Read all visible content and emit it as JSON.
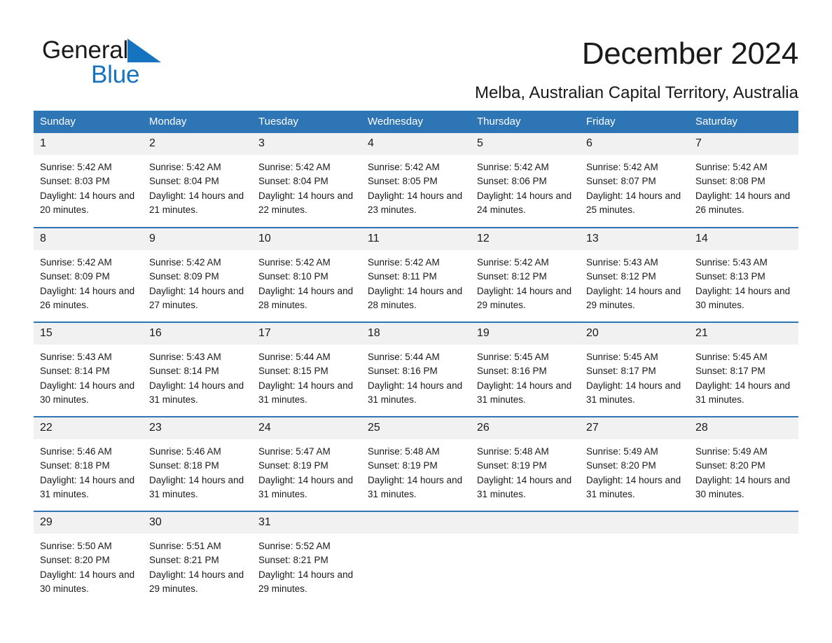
{
  "brand": {
    "name_part1": "General",
    "name_part2": "Blue",
    "triangle_color": "#1573c0"
  },
  "header": {
    "month_title": "December 2024",
    "location": "Melba, Australian Capital Territory, Australia",
    "accent_color": "#2e75b6",
    "daynum_band_color": "#f1f1f1"
  },
  "calendar": {
    "weekday_headers": [
      "Sunday",
      "Monday",
      "Tuesday",
      "Wednesday",
      "Thursday",
      "Friday",
      "Saturday"
    ],
    "weeks": [
      [
        {
          "day": "1",
          "sunrise": "Sunrise: 5:42 AM",
          "sunset": "Sunset: 8:03 PM",
          "daylight": "Daylight: 14 hours and 20 minutes."
        },
        {
          "day": "2",
          "sunrise": "Sunrise: 5:42 AM",
          "sunset": "Sunset: 8:04 PM",
          "daylight": "Daylight: 14 hours and 21 minutes."
        },
        {
          "day": "3",
          "sunrise": "Sunrise: 5:42 AM",
          "sunset": "Sunset: 8:04 PM",
          "daylight": "Daylight: 14 hours and 22 minutes."
        },
        {
          "day": "4",
          "sunrise": "Sunrise: 5:42 AM",
          "sunset": "Sunset: 8:05 PM",
          "daylight": "Daylight: 14 hours and 23 minutes."
        },
        {
          "day": "5",
          "sunrise": "Sunrise: 5:42 AM",
          "sunset": "Sunset: 8:06 PM",
          "daylight": "Daylight: 14 hours and 24 minutes."
        },
        {
          "day": "6",
          "sunrise": "Sunrise: 5:42 AM",
          "sunset": "Sunset: 8:07 PM",
          "daylight": "Daylight: 14 hours and 25 minutes."
        },
        {
          "day": "7",
          "sunrise": "Sunrise: 5:42 AM",
          "sunset": "Sunset: 8:08 PM",
          "daylight": "Daylight: 14 hours and 26 minutes."
        }
      ],
      [
        {
          "day": "8",
          "sunrise": "Sunrise: 5:42 AM",
          "sunset": "Sunset: 8:09 PM",
          "daylight": "Daylight: 14 hours and 26 minutes."
        },
        {
          "day": "9",
          "sunrise": "Sunrise: 5:42 AM",
          "sunset": "Sunset: 8:09 PM",
          "daylight": "Daylight: 14 hours and 27 minutes."
        },
        {
          "day": "10",
          "sunrise": "Sunrise: 5:42 AM",
          "sunset": "Sunset: 8:10 PM",
          "daylight": "Daylight: 14 hours and 28 minutes."
        },
        {
          "day": "11",
          "sunrise": "Sunrise: 5:42 AM",
          "sunset": "Sunset: 8:11 PM",
          "daylight": "Daylight: 14 hours and 28 minutes."
        },
        {
          "day": "12",
          "sunrise": "Sunrise: 5:42 AM",
          "sunset": "Sunset: 8:12 PM",
          "daylight": "Daylight: 14 hours and 29 minutes."
        },
        {
          "day": "13",
          "sunrise": "Sunrise: 5:43 AM",
          "sunset": "Sunset: 8:12 PM",
          "daylight": "Daylight: 14 hours and 29 minutes."
        },
        {
          "day": "14",
          "sunrise": "Sunrise: 5:43 AM",
          "sunset": "Sunset: 8:13 PM",
          "daylight": "Daylight: 14 hours and 30 minutes."
        }
      ],
      [
        {
          "day": "15",
          "sunrise": "Sunrise: 5:43 AM",
          "sunset": "Sunset: 8:14 PM",
          "daylight": "Daylight: 14 hours and 30 minutes."
        },
        {
          "day": "16",
          "sunrise": "Sunrise: 5:43 AM",
          "sunset": "Sunset: 8:14 PM",
          "daylight": "Daylight: 14 hours and 31 minutes."
        },
        {
          "day": "17",
          "sunrise": "Sunrise: 5:44 AM",
          "sunset": "Sunset: 8:15 PM",
          "daylight": "Daylight: 14 hours and 31 minutes."
        },
        {
          "day": "18",
          "sunrise": "Sunrise: 5:44 AM",
          "sunset": "Sunset: 8:16 PM",
          "daylight": "Daylight: 14 hours and 31 minutes."
        },
        {
          "day": "19",
          "sunrise": "Sunrise: 5:45 AM",
          "sunset": "Sunset: 8:16 PM",
          "daylight": "Daylight: 14 hours and 31 minutes."
        },
        {
          "day": "20",
          "sunrise": "Sunrise: 5:45 AM",
          "sunset": "Sunset: 8:17 PM",
          "daylight": "Daylight: 14 hours and 31 minutes."
        },
        {
          "day": "21",
          "sunrise": "Sunrise: 5:45 AM",
          "sunset": "Sunset: 8:17 PM",
          "daylight": "Daylight: 14 hours and 31 minutes."
        }
      ],
      [
        {
          "day": "22",
          "sunrise": "Sunrise: 5:46 AM",
          "sunset": "Sunset: 8:18 PM",
          "daylight": "Daylight: 14 hours and 31 minutes."
        },
        {
          "day": "23",
          "sunrise": "Sunrise: 5:46 AM",
          "sunset": "Sunset: 8:18 PM",
          "daylight": "Daylight: 14 hours and 31 minutes."
        },
        {
          "day": "24",
          "sunrise": "Sunrise: 5:47 AM",
          "sunset": "Sunset: 8:19 PM",
          "daylight": "Daylight: 14 hours and 31 minutes."
        },
        {
          "day": "25",
          "sunrise": "Sunrise: 5:48 AM",
          "sunset": "Sunset: 8:19 PM",
          "daylight": "Daylight: 14 hours and 31 minutes."
        },
        {
          "day": "26",
          "sunrise": "Sunrise: 5:48 AM",
          "sunset": "Sunset: 8:19 PM",
          "daylight": "Daylight: 14 hours and 31 minutes."
        },
        {
          "day": "27",
          "sunrise": "Sunrise: 5:49 AM",
          "sunset": "Sunset: 8:20 PM",
          "daylight": "Daylight: 14 hours and 31 minutes."
        },
        {
          "day": "28",
          "sunrise": "Sunrise: 5:49 AM",
          "sunset": "Sunset: 8:20 PM",
          "daylight": "Daylight: 14 hours and 30 minutes."
        }
      ],
      [
        {
          "day": "29",
          "sunrise": "Sunrise: 5:50 AM",
          "sunset": "Sunset: 8:20 PM",
          "daylight": "Daylight: 14 hours and 30 minutes."
        },
        {
          "day": "30",
          "sunrise": "Sunrise: 5:51 AM",
          "sunset": "Sunset: 8:21 PM",
          "daylight": "Daylight: 14 hours and 29 minutes."
        },
        {
          "day": "31",
          "sunrise": "Sunrise: 5:52 AM",
          "sunset": "Sunset: 8:21 PM",
          "daylight": "Daylight: 14 hours and 29 minutes."
        },
        {
          "day": "",
          "sunrise": "",
          "sunset": "",
          "daylight": ""
        },
        {
          "day": "",
          "sunrise": "",
          "sunset": "",
          "daylight": ""
        },
        {
          "day": "",
          "sunrise": "",
          "sunset": "",
          "daylight": ""
        },
        {
          "day": "",
          "sunrise": "",
          "sunset": "",
          "daylight": ""
        }
      ]
    ]
  }
}
